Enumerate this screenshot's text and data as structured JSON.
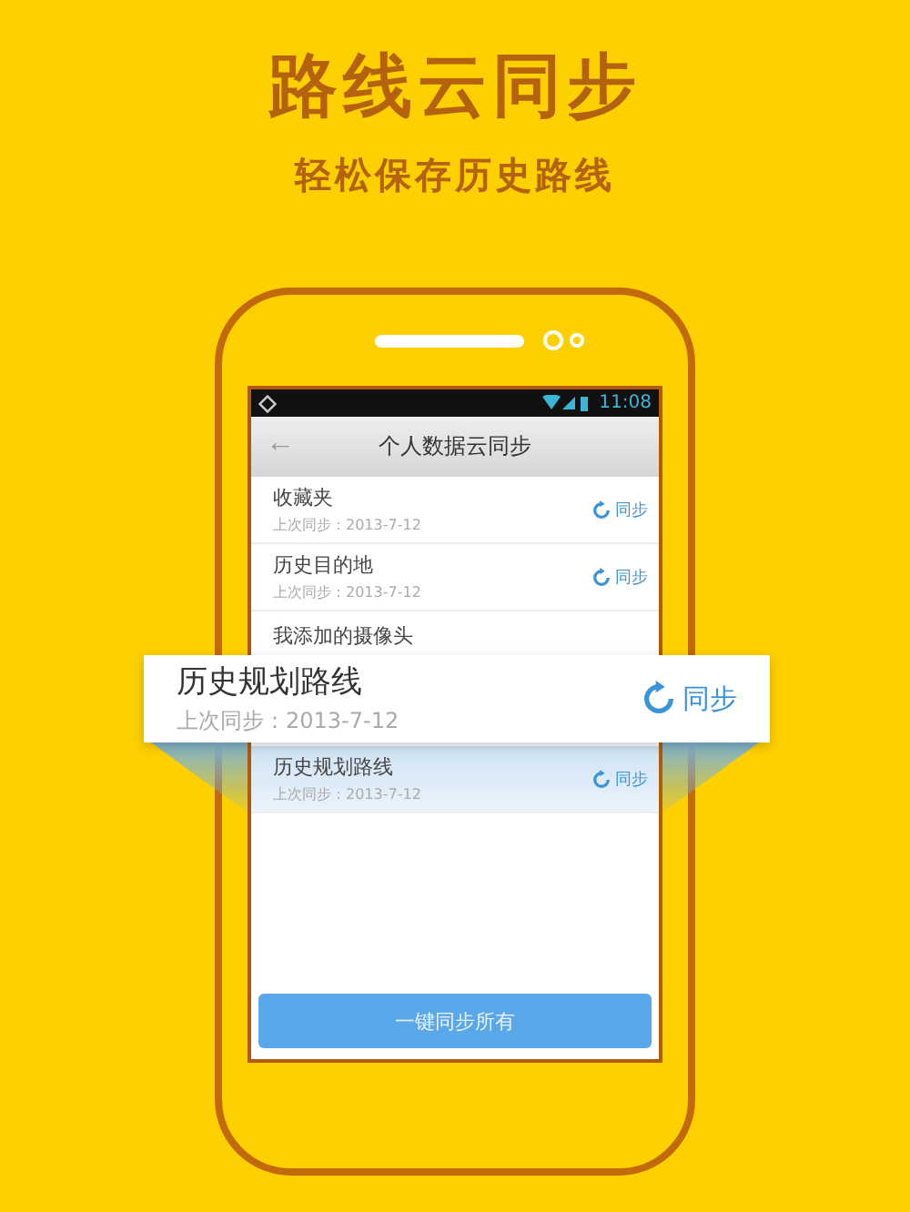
{
  "headline": "路线云同步",
  "subheadline": "轻松保存历史路线",
  "phone": {
    "status_bar": {
      "time": "11:08"
    },
    "app_bar": {
      "back": "←",
      "title": "个人数据云同步"
    },
    "items": [
      {
        "title": "收藏夹",
        "date": "上次同步：2013-7-12",
        "action": "同步",
        "selected": false
      },
      {
        "title": "历史目的地",
        "date": "上次同步：2013-7-12",
        "action": "同步",
        "selected": false
      },
      {
        "title": "我添加的摄像头",
        "selected": false
      },
      {
        "title": "历史规划路线",
        "date": "上次同步：2013-7-12",
        "action": "同步",
        "selected": true
      }
    ],
    "sync_all_button": "一键同步所有"
  },
  "callout": {
    "title": "历史规划路线",
    "date": "上次同步：2013-7-12",
    "action": "同步"
  }
}
